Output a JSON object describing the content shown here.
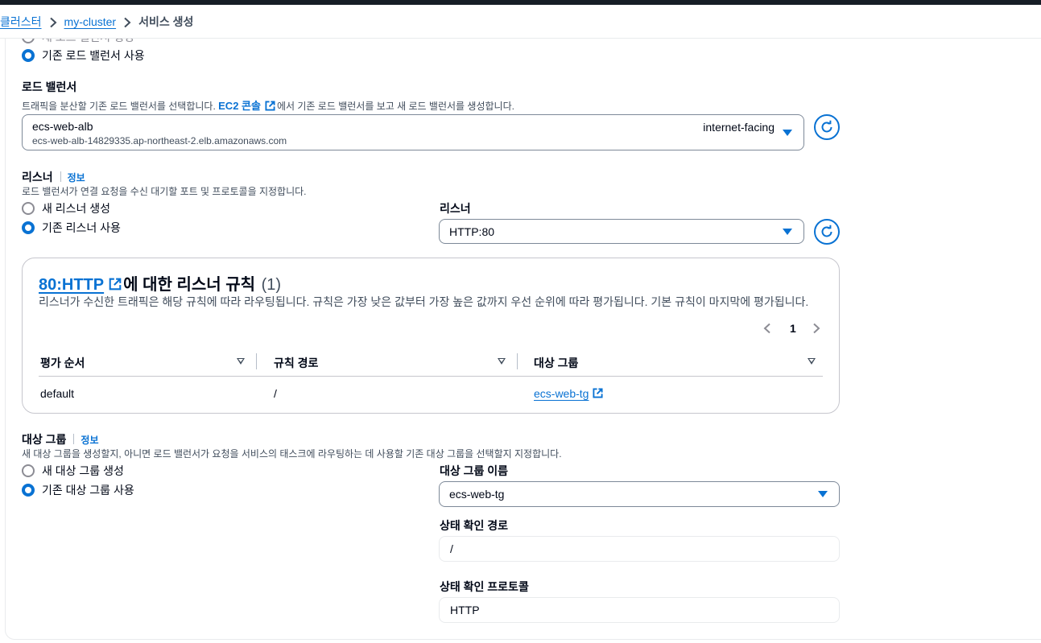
{
  "breadcrumb": {
    "items": [
      "클러스터",
      "my-cluster"
    ],
    "current": "서비스 생성"
  },
  "load_balancer_choice": {
    "create_new_label": "새 로드 밸런서 생성",
    "use_existing_label": "기존 로드 밸런서 사용",
    "selected": "use_existing"
  },
  "load_balancer": {
    "label": "로드 밸런서",
    "description_before": "트래픽을 분산할 기존 로드 밸런서를 선택합니다. ",
    "description_link": "EC2 콘솔",
    "description_after": "에서 기존 로드 밸런서를 보고 새 로드 밸런서를 생성합니다.",
    "selected_name": "ecs-web-alb",
    "selected_dns": "ecs-web-alb-14829335.ap-northeast-2.elb.amazonaws.com",
    "selected_scheme": "internet-facing"
  },
  "listener": {
    "label": "리스너",
    "info": "정보",
    "description": "로드 밸런서가 연결 요청을 수신 대기할 포트 및 프로토콜을 지정합니다.",
    "create_new_label": "새 리스너 생성",
    "use_existing_label": "기존 리스너 사용",
    "selected": "use_existing",
    "select_label": "리스너",
    "select_value": "HTTP:80"
  },
  "rules_card": {
    "title_link": "80:HTTP",
    "title_rest": "에 대한 리스너 규칙",
    "count": "(1)",
    "description": "리스너가 수신한 트래픽은 해당 규칙에 따라 라우팅됩니다. 규칙은 가장 낮은 값부터 가장 높은 값까지 우선 순위에 따라 평가됩니다. 기본 규칙이 마지막에 평가됩니다.",
    "page": "1",
    "columns": [
      "평가 순서",
      "규칙 경로",
      "대상 그룹"
    ],
    "rows": [
      {
        "order": "default",
        "path": "/",
        "target_group": "ecs-web-tg"
      }
    ]
  },
  "target_group": {
    "label": "대상 그룹",
    "info": "정보",
    "description": "새 대상 그룹을 생성할지, 아니면 로드 밸런서가 요청을 서비스의 태스크에 라우팅하는 데 사용할 기존 대상 그룹을 선택할지 지정합니다.",
    "create_new_label": "새 대상 그룹 생성",
    "use_existing_label": "기존 대상 그룹 사용",
    "selected": "use_existing",
    "name_label": "대상 그룹 이름",
    "name_value": "ecs-web-tg",
    "health_path_label": "상태 확인 경로",
    "health_path_value": "/",
    "health_protocol_label": "상태 확인 프로토콜",
    "health_protocol_value": "HTTP"
  },
  "colors": {
    "accent": "#0972d3",
    "text": "#000716",
    "secondary_text": "#414d5c",
    "topbar": "#161d26"
  }
}
